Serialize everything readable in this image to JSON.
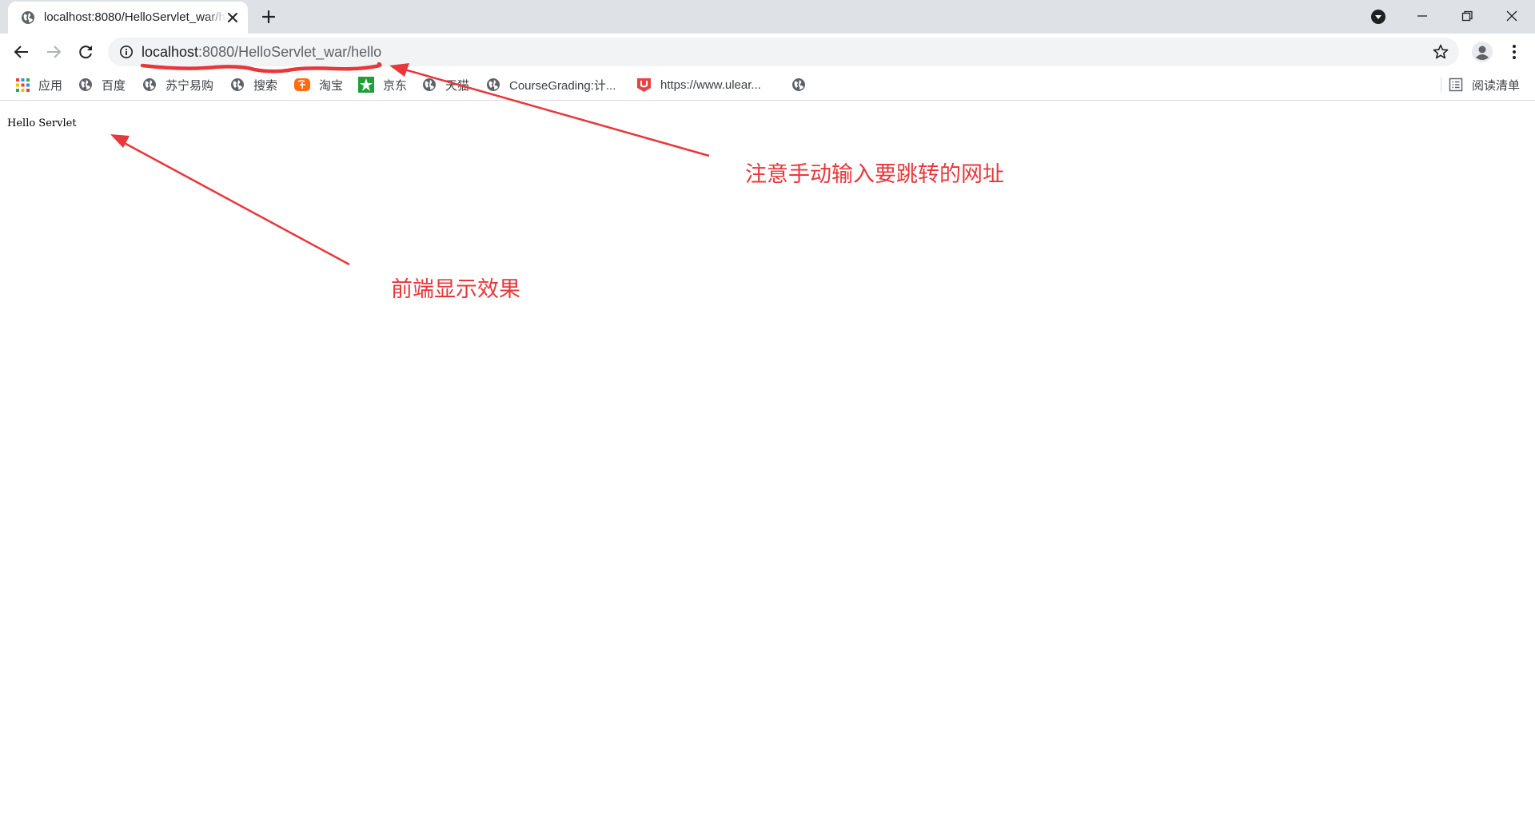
{
  "browser": {
    "tab": {
      "title": "localhost:8080/HelloServlet_war/hello"
    },
    "address": {
      "host": "localhost",
      "path": ":8080/HelloServlet_war/hello"
    },
    "bookmarks": [
      {
        "label": "应用",
        "icon": "apps-grid-icon"
      },
      {
        "label": "百度",
        "icon": "globe-icon"
      },
      {
        "label": "苏宁易购",
        "icon": "globe-icon"
      },
      {
        "label": "搜索",
        "icon": "globe-icon"
      },
      {
        "label": "淘宝",
        "icon": "taobao-icon"
      },
      {
        "label": "京东",
        "icon": "jd-icon"
      },
      {
        "label": "天猫",
        "icon": "globe-icon"
      },
      {
        "label": "CourseGrading:计...",
        "icon": "globe-icon"
      },
      {
        "label": "https://www.ulear...",
        "icon": "ulearning-icon"
      },
      {
        "label": "",
        "icon": "globe-icon"
      }
    ],
    "reading_list": "阅读清单"
  },
  "page": {
    "body_text": "Hello Servlet"
  },
  "annotations": {
    "url_note": "注意手动输入要跳转的网址",
    "display_note": "前端显示效果",
    "color": "#e8373b"
  },
  "theme": {
    "tabstrip_bg": "#dee1e6",
    "omnibox_bg": "#f1f3f4"
  }
}
